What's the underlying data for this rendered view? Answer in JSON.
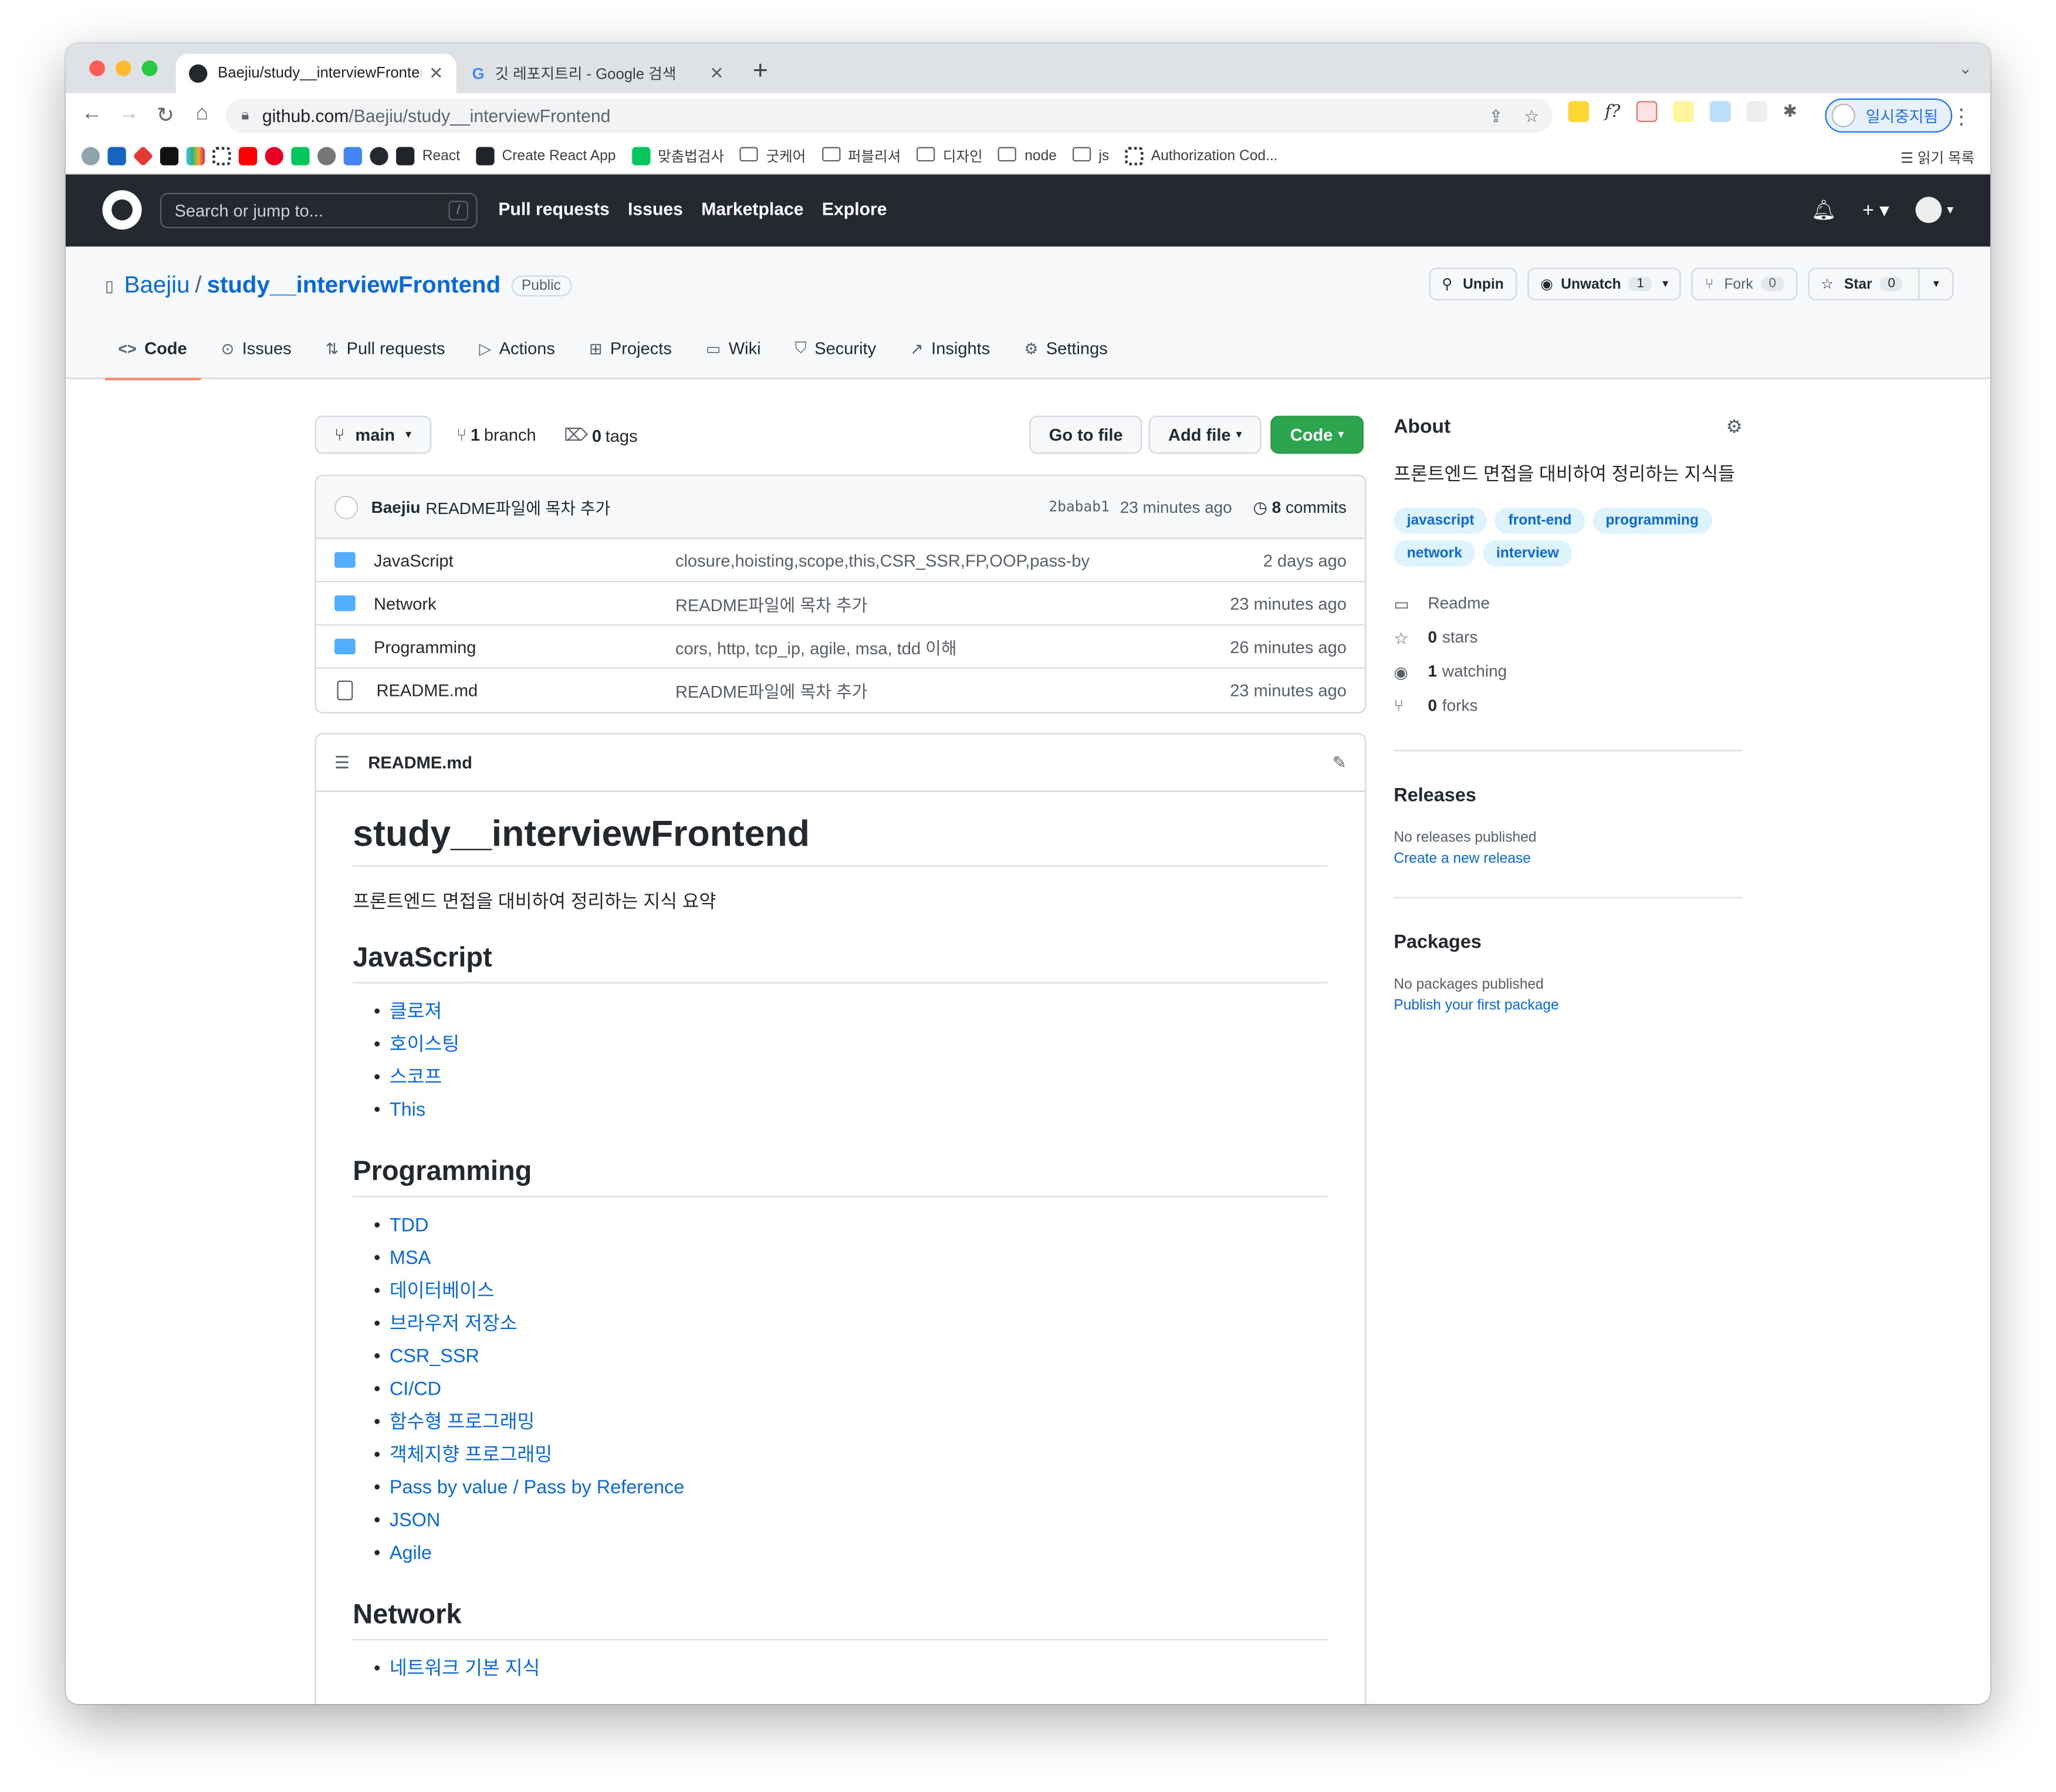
{
  "browser": {
    "tabs": [
      {
        "title": "Baejiu/study__interviewFrontend"
      },
      {
        "title": "깃 레포지트리 - Google 검색"
      }
    ],
    "url_host": "github.com",
    "url_path": "/Baejiu/study__interviewFrontend",
    "pause_label": "일시중지됨",
    "bookmarks": [
      "React",
      "Create React App",
      "맞춤법검사",
      "굿케어",
      "퍼블리셔",
      "디자인",
      "node",
      "js",
      "Authorization Cod..."
    ],
    "reading_list": "읽기 목록"
  },
  "github": {
    "search_placeholder": "Search or jump to...",
    "search_key": "/",
    "nav": [
      "Pull requests",
      "Issues",
      "Marketplace",
      "Explore"
    ]
  },
  "repo": {
    "owner": "Baejiu",
    "name": "study__interviewFrontend",
    "visibility": "Public",
    "buttons": {
      "unpin": "Unpin",
      "unwatch": "Unwatch",
      "watch_count": "1",
      "fork": "Fork",
      "fork_count": "0",
      "star": "Star",
      "star_count": "0"
    },
    "tabs": [
      "Code",
      "Issues",
      "Pull requests",
      "Actions",
      "Projects",
      "Wiki",
      "Security",
      "Insights",
      "Settings"
    ]
  },
  "code": {
    "branch": "main",
    "branches_count": "1",
    "branches_label": "branch",
    "tags_count": "0",
    "tags_label": "tags",
    "go_to_file": "Go to file",
    "add_file": "Add file",
    "code_btn": "Code",
    "commit": {
      "author": "Baejiu",
      "message": "README파일에 목차 추가",
      "hash": "2babab1",
      "age": "23 minutes ago",
      "commits_count": "8",
      "commits_label": "commits"
    },
    "files": [
      {
        "name": "JavaScript",
        "message": "closure,hoisting,scope,this,CSR_SSR,FP,OOP,pass-by",
        "age": "2 days ago"
      },
      {
        "name": "Network",
        "message": "README파일에 목차 추가",
        "age": "23 minutes ago"
      },
      {
        "name": "Programming",
        "message": "cors, http, tcp_ip, agile, msa, tdd 이해",
        "age": "26 minutes ago"
      },
      {
        "name": "README.md",
        "message": "README파일에 목차 추가",
        "age": "23 minutes ago"
      }
    ]
  },
  "readme": {
    "filename": "README.md",
    "title": "study__interviewFrontend",
    "intro": "프론트엔드 면접을 대비하여 정리하는 지식 요약",
    "sections": [
      {
        "heading": "JavaScript",
        "items": [
          "클로져",
          "호이스팅",
          "스코프",
          "This"
        ]
      },
      {
        "heading": "Programming",
        "items": [
          "TDD",
          "MSA",
          "데이터베이스",
          "브라우저 저장소",
          "CSR_SSR",
          "CI/CD",
          "함수형 프로그래밍",
          "객체지향 프로그래밍",
          "Pass by value / Pass by Reference",
          "JSON",
          "Agile"
        ]
      },
      {
        "heading": "Network",
        "items": [
          "네트워크 기본 지식"
        ]
      }
    ]
  },
  "about": {
    "title": "About",
    "description": "프론트엔드 면접을 대비하여 정리하는 지식들",
    "topics": [
      "javascript",
      "front-end",
      "programming",
      "network",
      "interview"
    ],
    "readme": "Readme",
    "stars_count": "0",
    "stars_label": "stars",
    "watching_count": "1",
    "watching_label": "watching",
    "forks_count": "0",
    "forks_label": "forks",
    "releases_title": "Releases",
    "releases_empty": "No releases published",
    "releases_link": "Create a new release",
    "packages_title": "Packages",
    "packages_empty": "No packages published",
    "packages_link": "Publish your first package"
  }
}
